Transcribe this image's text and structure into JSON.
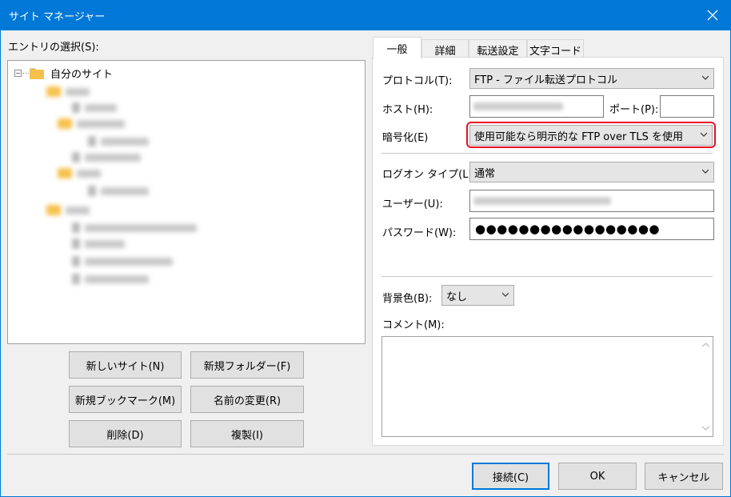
{
  "window": {
    "title": "サイト マネージャー",
    "close_icon": "close-icon"
  },
  "left": {
    "entry_label": "エントリの選択(S):",
    "tree": {
      "root_label": "自分のサイト",
      "expander": "−"
    },
    "buttons": {
      "new_site": "新しいサイト(N)",
      "new_folder": "新規フォルダー(F)",
      "new_bookmark": "新規ブックマーク(M)",
      "rename": "名前の変更(R)",
      "delete": "削除(D)",
      "duplicate": "複製(I)"
    }
  },
  "tabs": [
    {
      "label": "一般"
    },
    {
      "label": "詳細"
    },
    {
      "label": "転送設定"
    },
    {
      "label": "文字コード"
    }
  ],
  "general": {
    "protocol_label": "プロトコル(T):",
    "protocol_value": "FTP - ファイル転送プロトコル",
    "host_label": "ホスト(H):",
    "port_label": "ポート(P):",
    "port_value": "",
    "encryption_label": "暗号化(E)",
    "encryption_value": "使用可能なら明示的な FTP over TLS を使用",
    "logon_type_label": "ログオン タイプ(L):",
    "logon_type_value": "通常",
    "user_label": "ユーザー(U):",
    "password_label": "パスワード(W):",
    "password_value": "●●●●●●●●●●●●●●●●●",
    "bg_color_label": "背景色(B):",
    "bg_color_value": "なし",
    "comment_label": "コメント(M):",
    "comment_value": ""
  },
  "footer": {
    "connect": "接続(C)",
    "ok": "OK",
    "cancel": "キャンセル"
  },
  "colors": {
    "title_bar": "#0078d7",
    "highlight_border": "#e81123",
    "default_button_border": "#0078d7"
  }
}
